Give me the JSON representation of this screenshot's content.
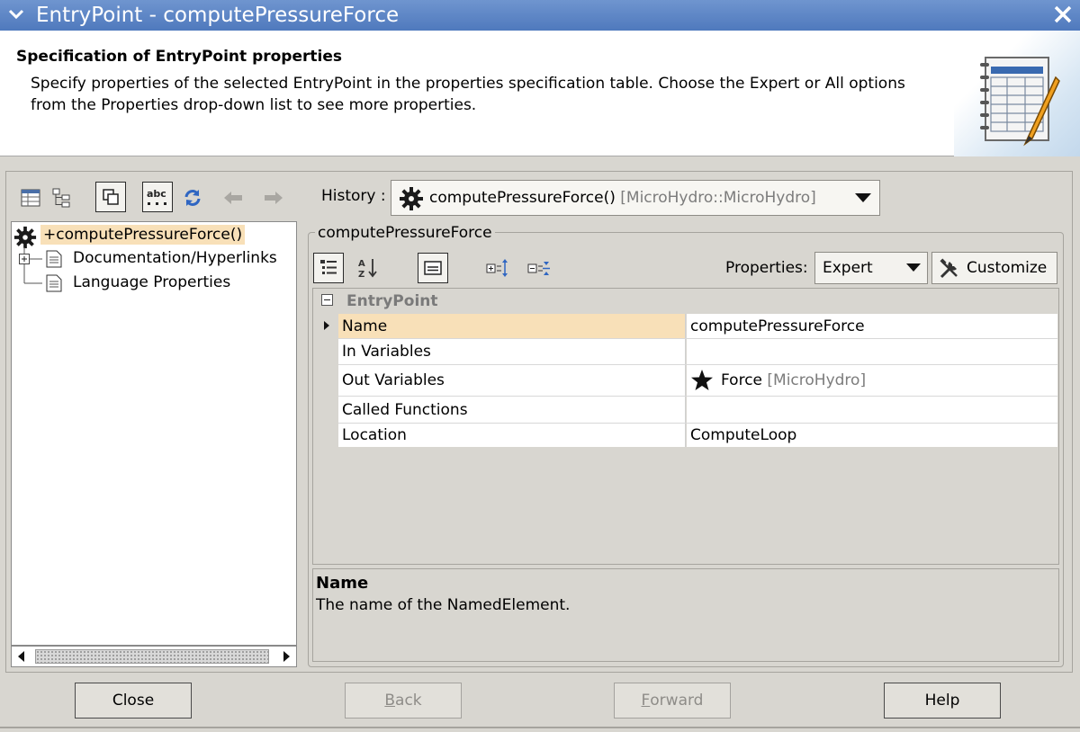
{
  "window": {
    "title": "EntryPoint - computePressureForce"
  },
  "header": {
    "title": "Specification of EntryPoint properties",
    "description": "Specify properties of the selected EntryPoint in the properties specification table. Choose the Expert or All options from the Properties drop-down list to see more properties."
  },
  "toolbar": {
    "history_label": "History :",
    "history_value": "computePressureForce()",
    "history_scope": "[MicroHydro::MicroHydro]"
  },
  "tree": {
    "root": "+computePressureForce()",
    "children": [
      "Documentation/Hyperlinks",
      "Language Properties"
    ]
  },
  "panel": {
    "title": "computePressureForce",
    "properties_label": "Properties:",
    "properties_value": "Expert",
    "customize_label": "Customize"
  },
  "table": {
    "group": "EntryPoint",
    "rows": [
      {
        "name": "Name",
        "value": "computePressureForce"
      },
      {
        "name": "In Variables",
        "value": ""
      },
      {
        "name": "Out Variables",
        "value": "Force",
        "scope": "[MicroHydro]",
        "icon": "star-icon"
      },
      {
        "name": "Called Functions",
        "value": ""
      },
      {
        "name": "Location",
        "value": "ComputeLoop"
      }
    ]
  },
  "description": {
    "title": "Name",
    "text": "The name of the NamedElement."
  },
  "buttons": {
    "close": "Close",
    "back_mnemonic": "B",
    "back_rest": "ack",
    "forward_mnemonic": "F",
    "forward_rest": "orward",
    "help": "Help"
  },
  "colors": {
    "titlebar": "#5a84c6",
    "selection": "#f8e0b8",
    "panel_bg": "#d8d6d0"
  }
}
